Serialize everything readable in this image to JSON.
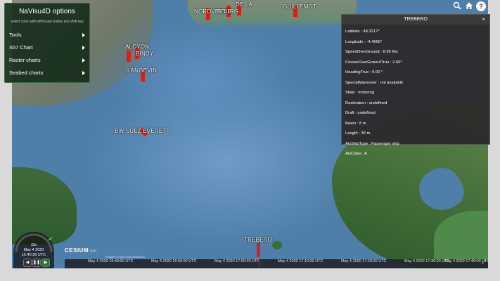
{
  "options_panel": {
    "title": "NaVisu4D options",
    "subtitle": "select zone with leftmouse button and shift key",
    "items": [
      {
        "label": "Tools"
      },
      {
        "label": "S57 Chart"
      },
      {
        "label": "Raster charts"
      },
      {
        "label": "Seabed charts"
      }
    ]
  },
  "map": {
    "ship_labels": [
      "NORDVERDE",
      "BOURG",
      "DE LA",
      "GUILLEMOT",
      "ALCYON",
      "BINDY",
      "LANGEVIN",
      "BW SUEZ EVERETT",
      "TREBERO"
    ]
  },
  "info_panel": {
    "title": "TREBERO",
    "close": "×",
    "rows": [
      "Latitude : 48.3217°",
      "Longitude : -4.4666°",
      "SpeedOverGround : 8.95 Kts",
      "CourseOverGroundTrue : 2.60°",
      "HeadingTrue : 0.00 °",
      "SpecialManeuver : not available",
      "State : motoring",
      "Destination : undefined",
      "Draft : undefined",
      "Beam : 8 m",
      "Length : 36 m",
      "AisShipType : Passenger ship",
      "AisClass : A"
    ]
  },
  "toolbar": {
    "search_icon": "search-icon",
    "home_icon": "home-icon",
    "help_label": "?"
  },
  "clock": {
    "speed": "33x",
    "date": "May 4 2020",
    "time": "15:40:36 UTC",
    "rewind": "◀",
    "pause": "❚❚",
    "play": "▶"
  },
  "cesium": {
    "logo": "CESIUM",
    "ion": "ion",
    "credits": "Imagery ©2020 Data attribution"
  },
  "timeline": {
    "labels": [
      "May 4 2020 16:40:00 UTC",
      "May 4 2020 16:50:00 UTC",
      "May 4 2020 17:00:00 UTC",
      "May 4 2020 17:10:00 UTC",
      "May 4 2020 17:20:00 UTC",
      "May 4 2020 17:30:00 UTC",
      "May 4 2020 17:40:00 UTC"
    ]
  },
  "colors": {
    "ship": "#e31b12",
    "panel_green": "#182e1c",
    "panel_dark": "#2a2a2a"
  }
}
